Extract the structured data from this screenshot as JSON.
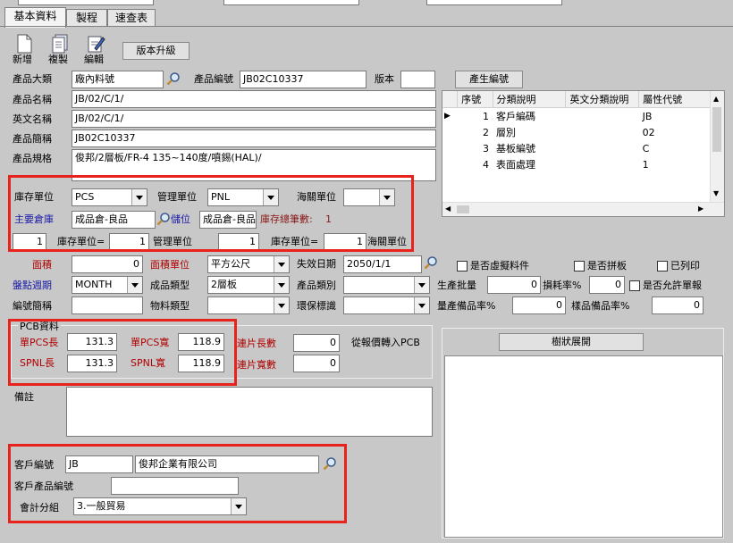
{
  "tabs": [
    {
      "label": "基本資料"
    },
    {
      "label": "製程"
    },
    {
      "label": "速查表"
    }
  ],
  "toolbar": {
    "new_label": "新增",
    "copy_label": "複製",
    "edit_label": "編輯",
    "upgrade_label": "版本升級"
  },
  "fields": {
    "category_label": "產品大類",
    "category_value": "廠內料號",
    "product_code_label": "產品編號",
    "product_code_value": "JB02C10337",
    "version_label": "版本",
    "version_value": "",
    "gen_code_label": "產生編號",
    "name_label": "產品名稱",
    "name_value": "JB/02/C/1/",
    "en_name_label": "英文名稱",
    "en_name_value": "JB/02/C/1/",
    "short_label": "產品簡稱",
    "short_value": "JB02C10337",
    "spec_label": "產品規格",
    "spec_value": "俊邦/2層板/FR-4 135~140度/噴錫(HAL)/"
  },
  "code_table": {
    "headers": [
      "序號",
      "分類說明",
      "英文分類說明",
      "屬性代號"
    ],
    "rows": [
      {
        "no": "1",
        "desc": "客戶編碼",
        "en": "",
        "code": "JB"
      },
      {
        "no": "2",
        "desc": "層別",
        "en": "",
        "code": "02"
      },
      {
        "no": "3",
        "desc": "基板編號",
        "en": "",
        "code": "C"
      },
      {
        "no": "4",
        "desc": "表面處理",
        "en": "",
        "code": "1"
      }
    ]
  },
  "stock": {
    "stock_unit_label": "庫存單位",
    "stock_unit_value": "PCS",
    "mgmt_unit_label": "管理單位",
    "mgmt_unit_value": "PNL",
    "customs_unit_label": "海關單位",
    "customs_unit_value": "",
    "main_wh_label": "主要倉庫",
    "main_wh_value": "成品倉-良品",
    "loc_label": "儲位",
    "loc_value": "成品倉-良品",
    "total_label": "庫存總筆數:",
    "total_value": "1",
    "conv1_value": "1",
    "conv1_label": "庫存單位=",
    "conv2_value": "1",
    "conv2_label": "管理單位",
    "conv3_value": "1",
    "conv3_label": "庫存單位=",
    "conv4_value": "1",
    "conv4_label": "海關單位"
  },
  "attrs": {
    "area_label": "面積",
    "area_value": "0",
    "area_unit_label": "面積單位",
    "area_unit_value": "平方公尺",
    "expire_label": "失效日期",
    "expire_value": "2050/1/1",
    "virtual_label": "是否虛擬料件",
    "panel_label": "是否拼板",
    "printed_label": "已列印",
    "cycle_label": "盤點週期",
    "cycle_value": "MONTH",
    "finished_type_label": "成品類型",
    "finished_type_value": "2層板",
    "product_cat_label": "產品類別",
    "product_cat_value": "",
    "batch_label": "生產批量",
    "batch_value": "0",
    "loss_label": "損耗率%",
    "loss_value": "0",
    "allow_label": "是否允許單報",
    "code_short_label": "編號簡稱",
    "code_short_value": "",
    "material_type_label": "物料類型",
    "material_type_value": "",
    "eco_label": "環保標識",
    "eco_value": "",
    "spare_label": "量產備品率%",
    "spare_value": "0",
    "sample_label": "樣品備品率%",
    "sample_value": "0"
  },
  "pcb": {
    "group_label": "PCB資料",
    "pcs_len_label": "單PCS長",
    "pcs_len_value": "131.3",
    "pcs_wid_label": "單PCS寬",
    "pcs_wid_value": "118.9",
    "spnl_len_label": "SPNL長",
    "spnl_len_value": "131.3",
    "spnl_wid_label": "SPNL寬",
    "spnl_wid_value": "118.9",
    "link_len_label": "連片長數",
    "link_len_value": "0",
    "link_wid_label": "連片寬數",
    "link_wid_value": "0",
    "quote_label": "從報價轉入PCB"
  },
  "tree": {
    "expand_label": "樹狀展開"
  },
  "notes": {
    "label": "備註",
    "value": ""
  },
  "customer": {
    "code_label": "客戶編號",
    "code_value": "JB",
    "name_value": "俊邦企業有限公司",
    "prod_code_label": "客戶產品編號",
    "prod_code_value": "",
    "acct_label": "會計分組",
    "acct_value": "3.一般貿易"
  },
  "colors": {
    "highlight": "#e8231b",
    "label_blue": "#1a1aa6",
    "label_red": "#b00000"
  }
}
